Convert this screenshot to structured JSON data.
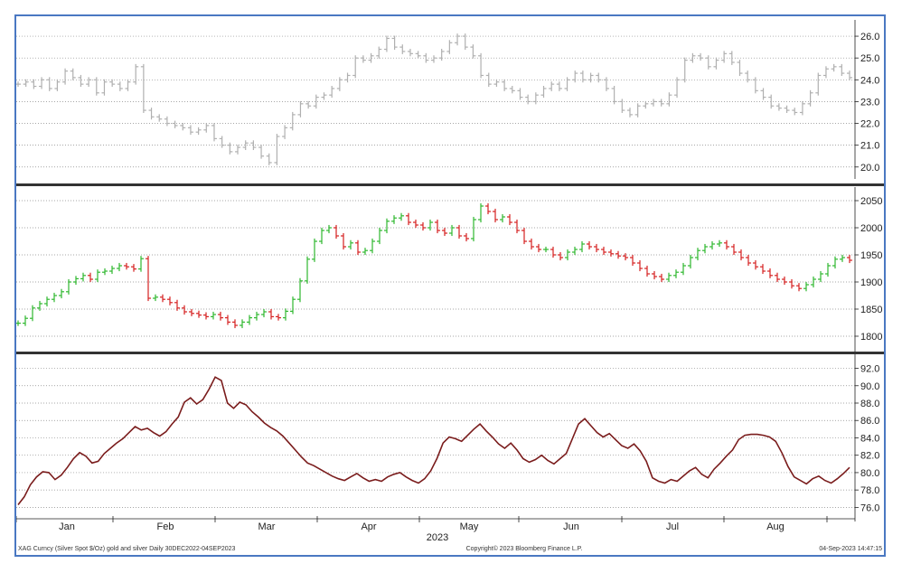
{
  "chart_data": [
    {
      "type": "ohlc",
      "yaxis_ticks": [
        "26.0",
        "25.0",
        "24.0",
        "23.0",
        "22.0",
        "21.0",
        "20.0"
      ],
      "ylim": [
        19.7,
        26.5
      ],
      "grid": true,
      "bar_color": "#b0b0b0",
      "close": [
        23.8,
        23.9,
        23.7,
        24.0,
        23.6,
        23.9,
        24.4,
        24.1,
        23.8,
        24.0,
        23.4,
        23.9,
        23.8,
        23.6,
        23.9,
        24.6,
        22.6,
        22.3,
        22.2,
        22.0,
        21.9,
        21.8,
        21.6,
        21.7,
        21.9,
        21.3,
        21.0,
        20.7,
        20.9,
        21.1,
        20.9,
        20.5,
        20.2,
        21.4,
        21.8,
        22.4,
        22.9,
        22.8,
        23.2,
        23.3,
        23.6,
        24.0,
        24.2,
        25.0,
        24.9,
        25.1,
        25.4,
        25.9,
        25.5,
        25.3,
        25.2,
        25.1,
        24.9,
        25.0,
        25.3,
        25.7,
        26.0,
        25.5,
        25.1,
        24.2,
        23.8,
        23.9,
        23.6,
        23.5,
        23.2,
        23.0,
        23.3,
        23.6,
        23.8,
        23.6,
        24.0,
        24.3,
        24.0,
        24.2,
        24.0,
        23.6,
        23.0,
        22.6,
        22.4,
        22.8,
        22.9,
        23.0,
        22.9,
        23.3,
        24.0,
        24.9,
        25.1,
        25.0,
        24.6,
        24.9,
        25.2,
        24.8,
        24.3,
        24.0,
        23.5,
        23.2,
        22.8,
        22.7,
        22.6,
        22.5,
        22.9,
        23.4,
        24.2,
        24.5,
        24.6,
        24.3,
        24.1
      ]
    },
    {
      "type": "ohlc",
      "yaxis_ticks": [
        "2050",
        "2000",
        "1950",
        "1900",
        "1850",
        "1800"
      ],
      "ylim": [
        1780,
        2065
      ],
      "grid": true,
      "up_color": "#2fb82f",
      "down_color": "#d62020",
      "close": [
        1824,
        1833,
        1852,
        1860,
        1868,
        1875,
        1882,
        1900,
        1906,
        1912,
        1905,
        1918,
        1920,
        1925,
        1930,
        1928,
        1924,
        1943,
        1870,
        1872,
        1868,
        1862,
        1852,
        1845,
        1842,
        1839,
        1836,
        1840,
        1834,
        1826,
        1820,
        1826,
        1834,
        1840,
        1845,
        1836,
        1834,
        1846,
        1868,
        1902,
        1942,
        1975,
        1995,
        2000,
        1985,
        1965,
        1972,
        1955,
        1958,
        1975,
        1995,
        2012,
        2018,
        2022,
        2010,
        2005,
        2000,
        2010,
        1995,
        1990,
        2000,
        1985,
        1980,
        2015,
        2040,
        2030,
        2015,
        2020,
        2010,
        1995,
        1975,
        1965,
        1960,
        1960,
        1950,
        1945,
        1955,
        1960,
        1970,
        1965,
        1960,
        1955,
        1952,
        1948,
        1945,
        1935,
        1925,
        1915,
        1910,
        1905,
        1912,
        1918,
        1930,
        1945,
        1958,
        1965,
        1970,
        1972,
        1965,
        1955,
        1945,
        1935,
        1928,
        1920,
        1912,
        1905,
        1900,
        1893,
        1888,
        1895,
        1905,
        1915,
        1930,
        1942,
        1945,
        1940
      ]
    },
    {
      "type": "line",
      "yaxis_ticks": [
        "92.0",
        "90.0",
        "88.0",
        "86.0",
        "84.0",
        "82.0",
        "80.0",
        "78.0",
        "76.0"
      ],
      "ylim": [
        75.0,
        93.2
      ],
      "grid": true,
      "line_color": "#7a1c1c",
      "values": [
        76.3,
        77.2,
        78.6,
        79.5,
        80.1,
        80.0,
        79.2,
        79.7,
        80.6,
        81.6,
        82.3,
        81.9,
        81.1,
        81.3,
        82.2,
        82.8,
        83.4,
        83.9,
        84.6,
        85.3,
        84.9,
        85.1,
        84.6,
        84.2,
        84.7,
        85.6,
        86.4,
        88.1,
        88.6,
        87.9,
        88.4,
        89.6,
        91.0,
        90.6,
        88.0,
        87.4,
        88.1,
        87.8,
        87.0,
        86.4,
        85.7,
        85.2,
        84.8,
        84.2,
        83.4,
        82.6,
        81.8,
        81.1,
        80.8,
        80.4,
        80.0,
        79.6,
        79.3,
        79.1,
        79.5,
        79.9,
        79.4,
        79.0,
        79.2,
        79.0,
        79.5,
        79.8,
        80.0,
        79.5,
        79.1,
        78.8,
        79.3,
        80.2,
        81.6,
        83.4,
        84.1,
        83.9,
        83.6,
        84.3,
        85.0,
        85.6,
        84.8,
        84.1,
        83.3,
        82.8,
        83.4,
        82.6,
        81.6,
        81.2,
        81.5,
        82.0,
        81.4,
        81.0,
        81.6,
        82.2,
        83.9,
        85.6,
        86.2,
        85.4,
        84.6,
        84.1,
        84.5,
        83.8,
        83.1,
        82.8,
        83.3,
        82.5,
        81.3,
        79.4,
        79.0,
        78.8,
        79.2,
        79.0,
        79.6,
        80.2,
        80.6,
        79.8,
        79.4,
        80.4,
        81.1,
        81.9,
        82.6,
        83.8,
        84.3,
        84.4,
        84.4,
        84.3,
        84.1,
        83.6,
        82.3,
        80.7,
        79.5,
        79.1,
        78.7,
        79.3,
        79.6,
        79.1,
        78.8,
        79.3,
        79.9,
        80.6
      ]
    }
  ],
  "x_axis": {
    "months": [
      "Jan",
      "Feb",
      "Mar",
      "Apr",
      "May",
      "Jun",
      "Jul",
      "Aug"
    ],
    "year": "2023"
  },
  "footer": {
    "left": "XAG Curncy (Silver Spot  $/Oz) gold and silver  Daily 30DEC2022-04SEP2023",
    "center": "Copyright© 2023 Bloomberg Finance L.P.",
    "right": "04-Sep-2023  14:47:15"
  },
  "colors": {
    "frame": "#4a78c2",
    "separator": "#333333",
    "grid": "#8a8a8a"
  }
}
